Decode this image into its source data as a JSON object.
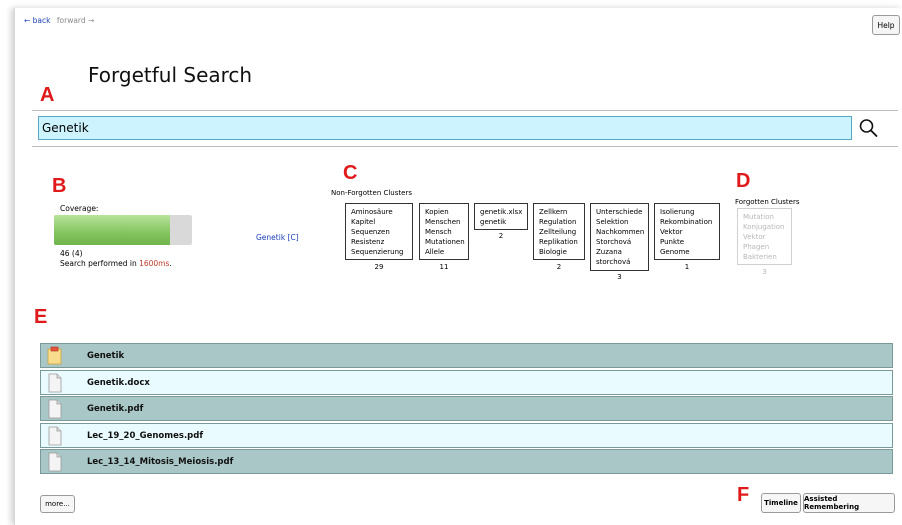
{
  "nav": {
    "back": "← back",
    "forward": "forward →"
  },
  "help_label": "Help",
  "title": "Forgetful Search",
  "letters": {
    "a": "A",
    "b": "B",
    "c": "C",
    "d": "D",
    "e": "E",
    "f": "F"
  },
  "search": {
    "value": "Genetik",
    "icon": "search-icon"
  },
  "stats": {
    "coverage_label": "Coverage:",
    "coverage_fraction": 0.84,
    "count": "46 (4)",
    "time_prefix": "Search performed in ",
    "time_value": "1600ms",
    "time_suffix": "."
  },
  "query_link": "Genetik [C]",
  "non_forgotten": {
    "label": "Non-Forgotten Clusters",
    "clusters": [
      {
        "terms": [
          "Aminosäure",
          "Kapitel",
          "Sequenzen",
          "Resistenz",
          "Sequenzierung"
        ],
        "count": "29"
      },
      {
        "terms": [
          "Kopien",
          "Menschen",
          "Mensch",
          "Mutationen",
          "Allele"
        ],
        "count": "11"
      },
      {
        "terms": [
          "genetik.xlsx",
          "genetik"
        ],
        "count": "2"
      },
      {
        "terms": [
          "Zellkern",
          "Regulation",
          "Zellteilung",
          "Replikation",
          "Biologie"
        ],
        "count": "2"
      },
      {
        "terms": [
          "Unterschiede",
          "Selektion",
          "Nachkommen",
          "Storchová",
          "Zuzana",
          "storchová"
        ],
        "count": "3"
      },
      {
        "terms": [
          "Isolierung",
          "Rekombination",
          "Vektor",
          "Punkte",
          "Genome"
        ],
        "count": "1"
      }
    ]
  },
  "forgotten": {
    "label": "Forgotten Clusters",
    "terms": [
      "Mutation",
      "Konjugation",
      "Vektor",
      "Phagen",
      "Bakterien"
    ],
    "count": "3"
  },
  "results": [
    {
      "label": "Genetik",
      "icon": "folder-note-icon"
    },
    {
      "label": "Genetik.docx",
      "icon": "document-icon"
    },
    {
      "label": "Genetik.pdf",
      "icon": "document-icon"
    },
    {
      "label": "Lec_19_20_Genomes.pdf",
      "icon": "document-icon"
    },
    {
      "label": "Lec_13_14_Mitosis_Meiosis.pdf",
      "icon": "document-icon"
    }
  ],
  "buttons": {
    "more": "more...",
    "timeline": "Timeline",
    "assisted": "Assisted Remembering"
  },
  "colors": {
    "row_dark": "#a9c7c7",
    "row_light": "#e9fbff",
    "search_bg": "#cdf3ff",
    "letter_red": "#e0191b",
    "link_blue": "#1a3fb8"
  }
}
